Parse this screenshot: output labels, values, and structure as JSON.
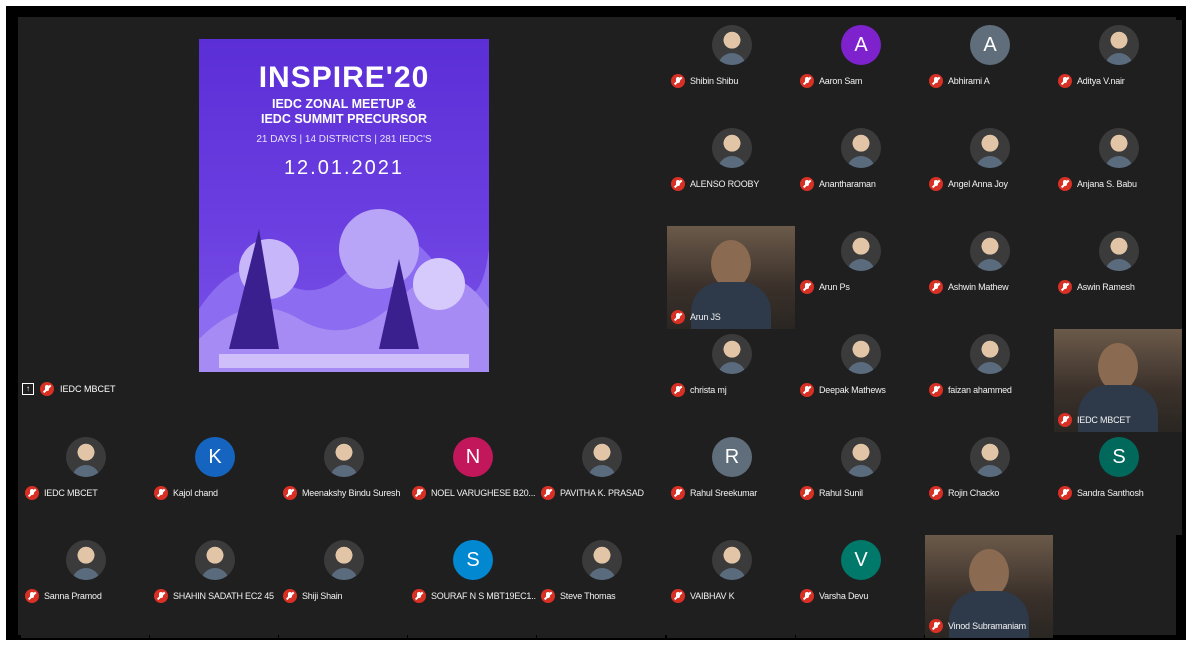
{
  "presentation": {
    "presenter_label": "IEDC MBCET",
    "poster": {
      "title": "INSPIRE'20",
      "line1": "IEDC ZONAL MEETUP &",
      "line2": "IEDC SUMMIT PRECURSOR",
      "stats": "21 DAYS | 14 DISTRICTS | 281 IEDC'S",
      "date": "12.01.2021"
    }
  },
  "participants": [
    {
      "name": "Shibin Shibu",
      "avatar": "photo"
    },
    {
      "name": "Aaron Sam",
      "initial": "A",
      "color": "#7e22ce"
    },
    {
      "name": "Abhirami A",
      "initial": "A",
      "color": "#5f6e7a"
    },
    {
      "name": "Aditya V.nair",
      "avatar": "photo"
    },
    {
      "name": "ALENSO ROOBY",
      "avatar": "photo"
    },
    {
      "name": "Anantharaman",
      "avatar": "photo"
    },
    {
      "name": "Angel Anna Joy",
      "avatar": "photo"
    },
    {
      "name": "Anjana S. Babu",
      "avatar": "photo"
    },
    {
      "name": "Arun JS",
      "avatar": "video"
    },
    {
      "name": "Arun Ps",
      "avatar": "photo"
    },
    {
      "name": "Ashwin Mathew",
      "avatar": "photo"
    },
    {
      "name": "Aswin Ramesh",
      "avatar": "photo"
    },
    {
      "name": "christa mj",
      "avatar": "photo"
    },
    {
      "name": "Deepak Mathews",
      "avatar": "photo"
    },
    {
      "name": "faizan ahammed",
      "avatar": "photo"
    },
    {
      "name": "IEDC MBCET",
      "avatar": "video"
    },
    {
      "name": "IEDC MBCET",
      "avatar": "photo"
    },
    {
      "name": "Kajol chand",
      "initial": "K",
      "color": "#1565c0"
    },
    {
      "name": "Meenakshy Bindu Suresh",
      "avatar": "photo"
    },
    {
      "name": "NOEL VARUGHESE B20...",
      "initial": "N",
      "color": "#c2185b"
    },
    {
      "name": "PAVITHA K. PRASAD",
      "avatar": "photo"
    },
    {
      "name": "Rahul Sreekumar",
      "initial": "R",
      "color": "#5f6e7a"
    },
    {
      "name": "Rahul Sunil",
      "avatar": "photo"
    },
    {
      "name": "Rojin Chacko",
      "avatar": "photo"
    },
    {
      "name": "Sandra Santhosh",
      "initial": "S",
      "color": "#00695c"
    },
    {
      "name": "Sanna Pramod",
      "avatar": "photo"
    },
    {
      "name": "SHAHIN SADATH EC2 45",
      "avatar": "photo"
    },
    {
      "name": "Shiji Shain",
      "avatar": "photo"
    },
    {
      "name": "SOURAF N S MBT19EC1...",
      "initial": "S",
      "color": "#0288d1"
    },
    {
      "name": "Steve Thomas",
      "avatar": "photo"
    },
    {
      "name": "VAIBHAV K",
      "avatar": "photo"
    },
    {
      "name": "Varsha Devu",
      "initial": "V",
      "color": "#00796b"
    },
    {
      "name": "Vinod Subramaniam",
      "avatar": "video"
    }
  ]
}
